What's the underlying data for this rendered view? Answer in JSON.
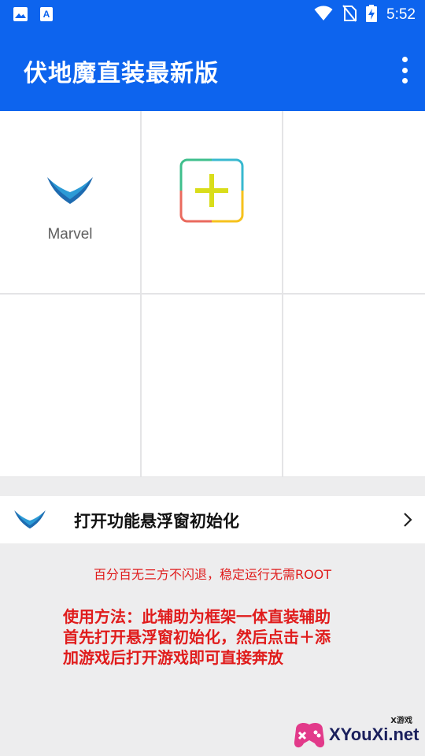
{
  "status_bar": {
    "time": "5:52",
    "left_icons": [
      "image-icon",
      "a-letter-icon"
    ],
    "right_icons": [
      "wifi-icon",
      "no-sim-icon",
      "battery-charging-icon"
    ]
  },
  "app_bar": {
    "title": "伏地魔直装最新版",
    "menu_icon": "more-vert-icon",
    "color": "#0d64ee"
  },
  "grid": {
    "apps": [
      {
        "label": "Marvel",
        "icon": "marvel-wings-icon"
      }
    ],
    "add_button_icon": "add-plus-icon"
  },
  "panel": {
    "label": "打开功能悬浮窗初始化",
    "icon": "marvel-wings-icon",
    "chevron": "chevron-right-icon"
  },
  "notice": "百分百无三方不闪退，稳定运行无需ROOT",
  "usage_lines": [
    "使用方法：此辅助为框架一体直装辅助",
    "首先打开悬浮窗初始化，然后点击＋添",
    "加游戏后打开游戏即可直接奔放"
  ],
  "watermark": {
    "small": "X游戏",
    "text": "XYouXi.net"
  },
  "colors": {
    "accent": "#0d64ee",
    "warning_text": "#e01c1c"
  }
}
